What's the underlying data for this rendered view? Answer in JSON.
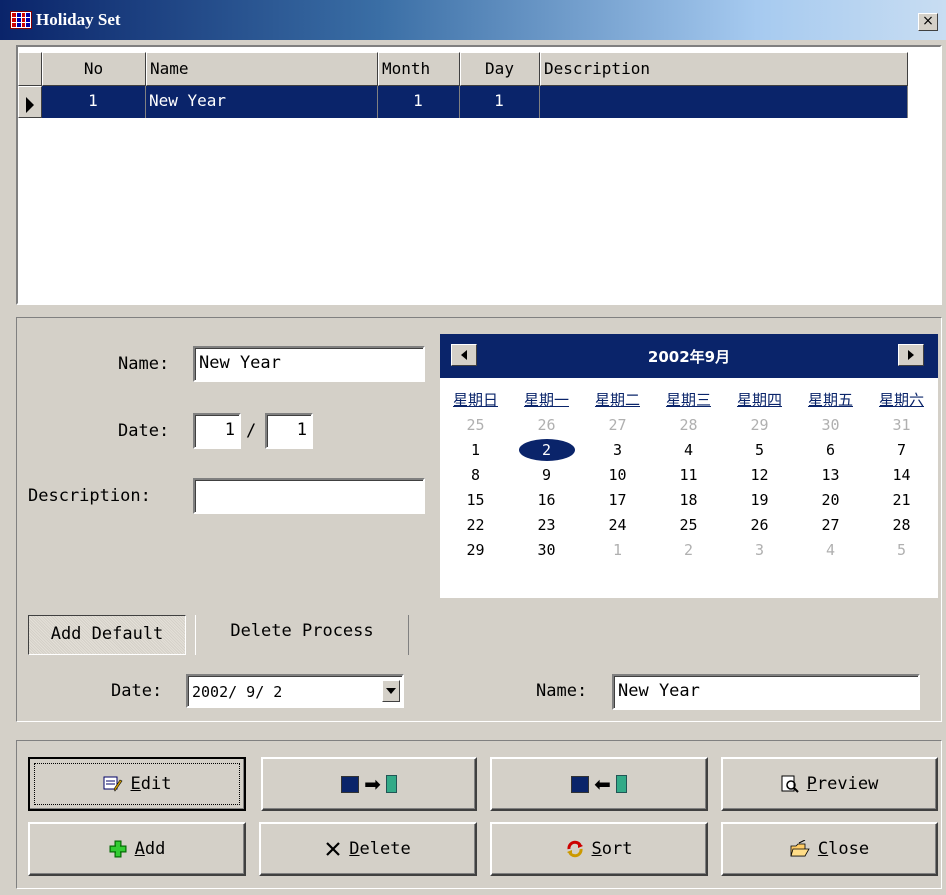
{
  "window": {
    "title": "Holiday Set",
    "close_label": "×"
  },
  "grid": {
    "columns": [
      "No",
      "Name",
      "Month",
      "Day",
      "Description"
    ],
    "rows": [
      {
        "no": "1",
        "name": "New Year",
        "month": "1",
        "day": "1",
        "description": ""
      }
    ]
  },
  "form": {
    "name_label": "Name:",
    "name_value": "New Year",
    "date_label": "Date:",
    "month_value": "1",
    "date_sep": "/",
    "day_value": "1",
    "description_label": "Description:",
    "description_value": ""
  },
  "calendar": {
    "title": "2002年9月",
    "weekdays": [
      "星期日",
      "星期一",
      "星期二",
      "星期三",
      "星期四",
      "星期五",
      "星期六"
    ],
    "weeks": [
      [
        "25",
        "26",
        "27",
        "28",
        "29",
        "30",
        "31"
      ],
      [
        "1",
        "2",
        "3",
        "4",
        "5",
        "6",
        "7"
      ],
      [
        "8",
        "9",
        "10",
        "11",
        "12",
        "13",
        "14"
      ],
      [
        "15",
        "16",
        "17",
        "18",
        "19",
        "20",
        "21"
      ],
      [
        "22",
        "23",
        "24",
        "25",
        "26",
        "27",
        "28"
      ],
      [
        "29",
        "30",
        "1",
        "2",
        "3",
        "4",
        "5"
      ]
    ],
    "selected_day": "2"
  },
  "tabs": {
    "add_default": "Add Default",
    "delete_process": "Delete Process"
  },
  "lower": {
    "date_label": "Date:",
    "date_value": "2002/ 9/ 2",
    "name_label": "Name:",
    "name_value": "New Year"
  },
  "buttons": {
    "edit": "Edit",
    "preview": "Preview",
    "add": "Add",
    "delete": "Delete",
    "sort": "Sort",
    "close": "Close"
  },
  "icons": {
    "edit": "edit-icon",
    "upload": "pc-to-phone-icon",
    "download": "phone-to-pc-icon",
    "preview": "magnifier-icon",
    "add": "plus-icon",
    "delete": "x-icon",
    "sort": "sort-icon",
    "close": "folder-icon"
  }
}
